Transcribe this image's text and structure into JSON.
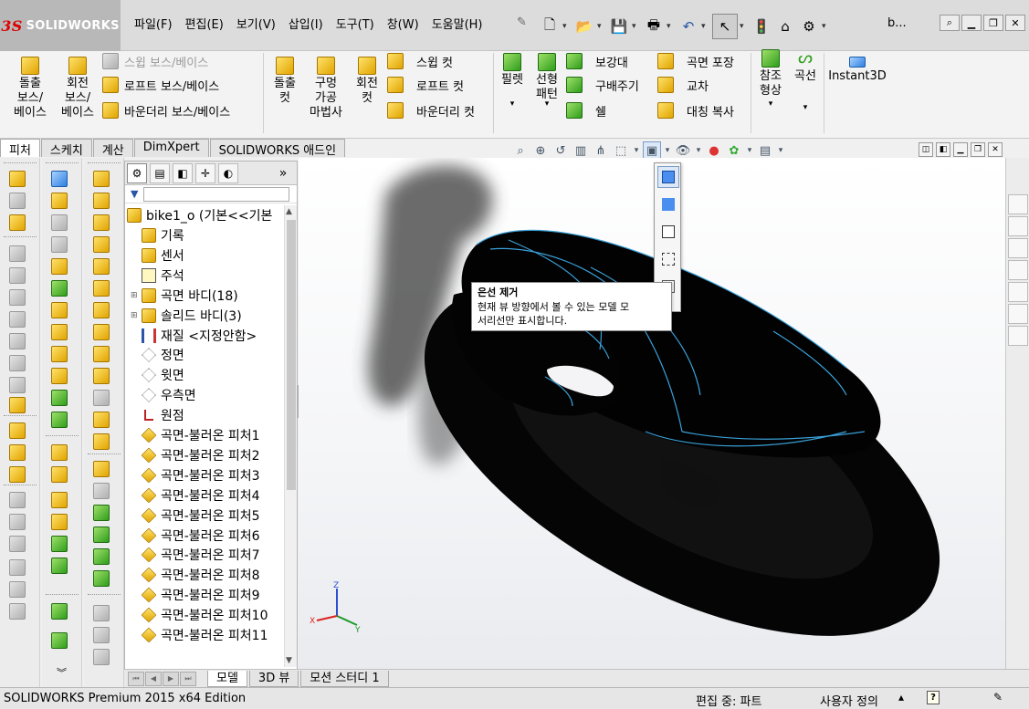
{
  "app": {
    "logo": "SOLIDWORKS",
    "doc_short": "b...",
    "colors": {
      "accent": "#3aa0d8",
      "model": "#000000",
      "logo_bg": "#b8b8b8"
    }
  },
  "menu": [
    "파일(F)",
    "편집(E)",
    "보기(V)",
    "삽입(I)",
    "도구(T)",
    "창(W)",
    "도움말(H)"
  ],
  "quick_toolbar": [
    "new-doc-icon",
    "open-icon",
    "save-icon",
    "print-icon",
    "undo-icon",
    "select-icon",
    "rebuild-icon",
    "options-icon"
  ],
  "ribbon": {
    "extrude_boss": "돌출\n보스/\n베이스",
    "revolve_boss": "회전\n보스/\n베이스",
    "sweep_boss": "스윕 보스/베이스",
    "loft_boss": "로프트 보스/베이스",
    "boundary_boss": "바운더리 보스/베이스",
    "extrude_cut": "돌출\n컷",
    "hole_wizard": "구멍\n가공\n마법사",
    "revolve_cut": "회전\n컷",
    "sweep_cut": "스윕 컷",
    "loft_cut": "로프트 컷",
    "boundary_cut": "바운더리 컷",
    "fillet": "필렛",
    "linear_pattern": "선형\n패턴",
    "rib": "보강대",
    "draft": "구배주기",
    "shell": "쉘",
    "wrap": "곡면 포장",
    "intersect": "교차",
    "mirror": "대칭 복사",
    "ref_geometry": "참조\n형상",
    "curves": "곡선",
    "instant3d": "Instant3D"
  },
  "tabs": [
    "피처",
    "스케치",
    "계산",
    "DimXpert",
    "SOLIDWORKS 애드인"
  ],
  "feature_manager": {
    "root": "bike1_o  (기본<<기본",
    "items": [
      {
        "label": "기록",
        "icon": "history-icon"
      },
      {
        "label": "센서",
        "icon": "sensor-icon"
      },
      {
        "label": "주석",
        "icon": "annotation-icon"
      },
      {
        "label": "곡면 바디(18)",
        "icon": "surface-bodies-icon"
      },
      {
        "label": "솔리드 바디(3)",
        "icon": "solid-bodies-icon"
      },
      {
        "label": "재질 <지정안함>",
        "icon": "material-icon"
      },
      {
        "label": "정면",
        "icon": "plane-icon"
      },
      {
        "label": "윗면",
        "icon": "plane-icon"
      },
      {
        "label": "우측면",
        "icon": "plane-icon"
      },
      {
        "label": "원점",
        "icon": "origin-icon"
      },
      {
        "label": "곡면-불러온 피처1",
        "icon": "imported-surface-icon"
      },
      {
        "label": "곡면-불러온 피처2",
        "icon": "imported-surface-icon"
      },
      {
        "label": "곡면-불러온 피처3",
        "icon": "imported-surface-icon"
      },
      {
        "label": "곡면-불러온 피처4",
        "icon": "imported-surface-icon"
      },
      {
        "label": "곡면-불러온 피처5",
        "icon": "imported-surface-icon"
      },
      {
        "label": "곡면-불러온 피처6",
        "icon": "imported-surface-icon"
      },
      {
        "label": "곡면-불러온 피처7",
        "icon": "imported-surface-icon"
      },
      {
        "label": "곡면-불러온 피처8",
        "icon": "imported-surface-icon"
      },
      {
        "label": "곡면-불러온 피처9",
        "icon": "imported-surface-icon"
      },
      {
        "label": "곡면-불러온 피처10",
        "icon": "imported-surface-icon"
      },
      {
        "label": "곡면-불러온 피처11",
        "icon": "imported-surface-icon"
      }
    ]
  },
  "tooltip": {
    "title": "은선 제거",
    "body1": "현재 뷰 방향에서 볼 수 있는 모델 모",
    "body2": "서리선만 표시합니다."
  },
  "triad": {
    "x": "X",
    "y": "Y",
    "z": "Z"
  },
  "bottom_tabs": [
    "모델",
    "3D 뷰",
    "모션 스터디 1"
  ],
  "status": {
    "edition": "SOLIDWORKS Premium 2015 x64 Edition",
    "editing": "편집 중: 파트",
    "custom": "사용자 정의"
  }
}
